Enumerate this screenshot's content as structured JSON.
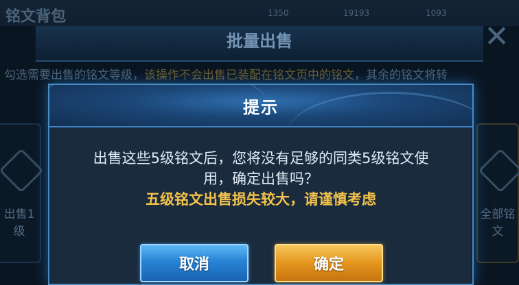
{
  "background": {
    "panel_title": "铭文背包",
    "stats": [
      "1350",
      "19193",
      "1093"
    ],
    "header_title": "批量出售",
    "close_icon": "close-icon",
    "description_normal": "勾选需要出售的铭文等级，",
    "description_warning": "该操作不会出售已装配在铭文页中的铭文",
    "description_tail": "，其余的铭文将转",
    "left_card_label": "出售1级",
    "right_card_label": "全部铭文"
  },
  "dialog": {
    "title": "提示",
    "message_line1": "出售这些5级铭文后，您将没有足够的同类5级铭文使",
    "message_line2": "用，确定出售吗？",
    "warning": "五级铭文出售损失较大，请谨慎考虑",
    "cancel_label": "取消",
    "confirm_label": "确定"
  },
  "colors": {
    "accent_blue": "#2783d4",
    "confirm_gold": "#e4961f",
    "warning_text": "#f3c24a"
  }
}
